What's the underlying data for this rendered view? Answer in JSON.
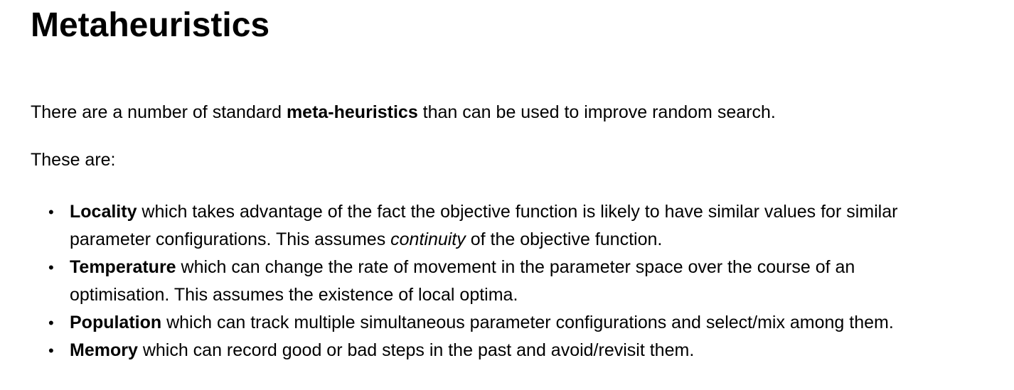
{
  "title": "Metaheuristics",
  "intro": {
    "before": "There are a number of standard ",
    "bold": "meta-heuristics",
    "after": " than can be used to improve random search."
  },
  "lead": "These are:",
  "items": [
    {
      "term": "Locality",
      "line1": " which takes advantage of the fact the objective function is likely to have similar values for similar",
      "line2_before": "parameter configurations. This assumes ",
      "line2_italic": "continuity",
      "line2_after": " of the objective function."
    },
    {
      "term": "Temperature",
      "line1": " which can change the rate of movement in the parameter space over the course of an",
      "line2": "optimisation. This assumes the existence of local optima."
    },
    {
      "term": "Population",
      "line1": " which can track multiple simultaneous parameter configurations and select/mix among them."
    },
    {
      "term": "Memory",
      "line1": " which can record good or bad steps in the past and avoid/revisit them."
    }
  ],
  "bullet_glyph": "•"
}
